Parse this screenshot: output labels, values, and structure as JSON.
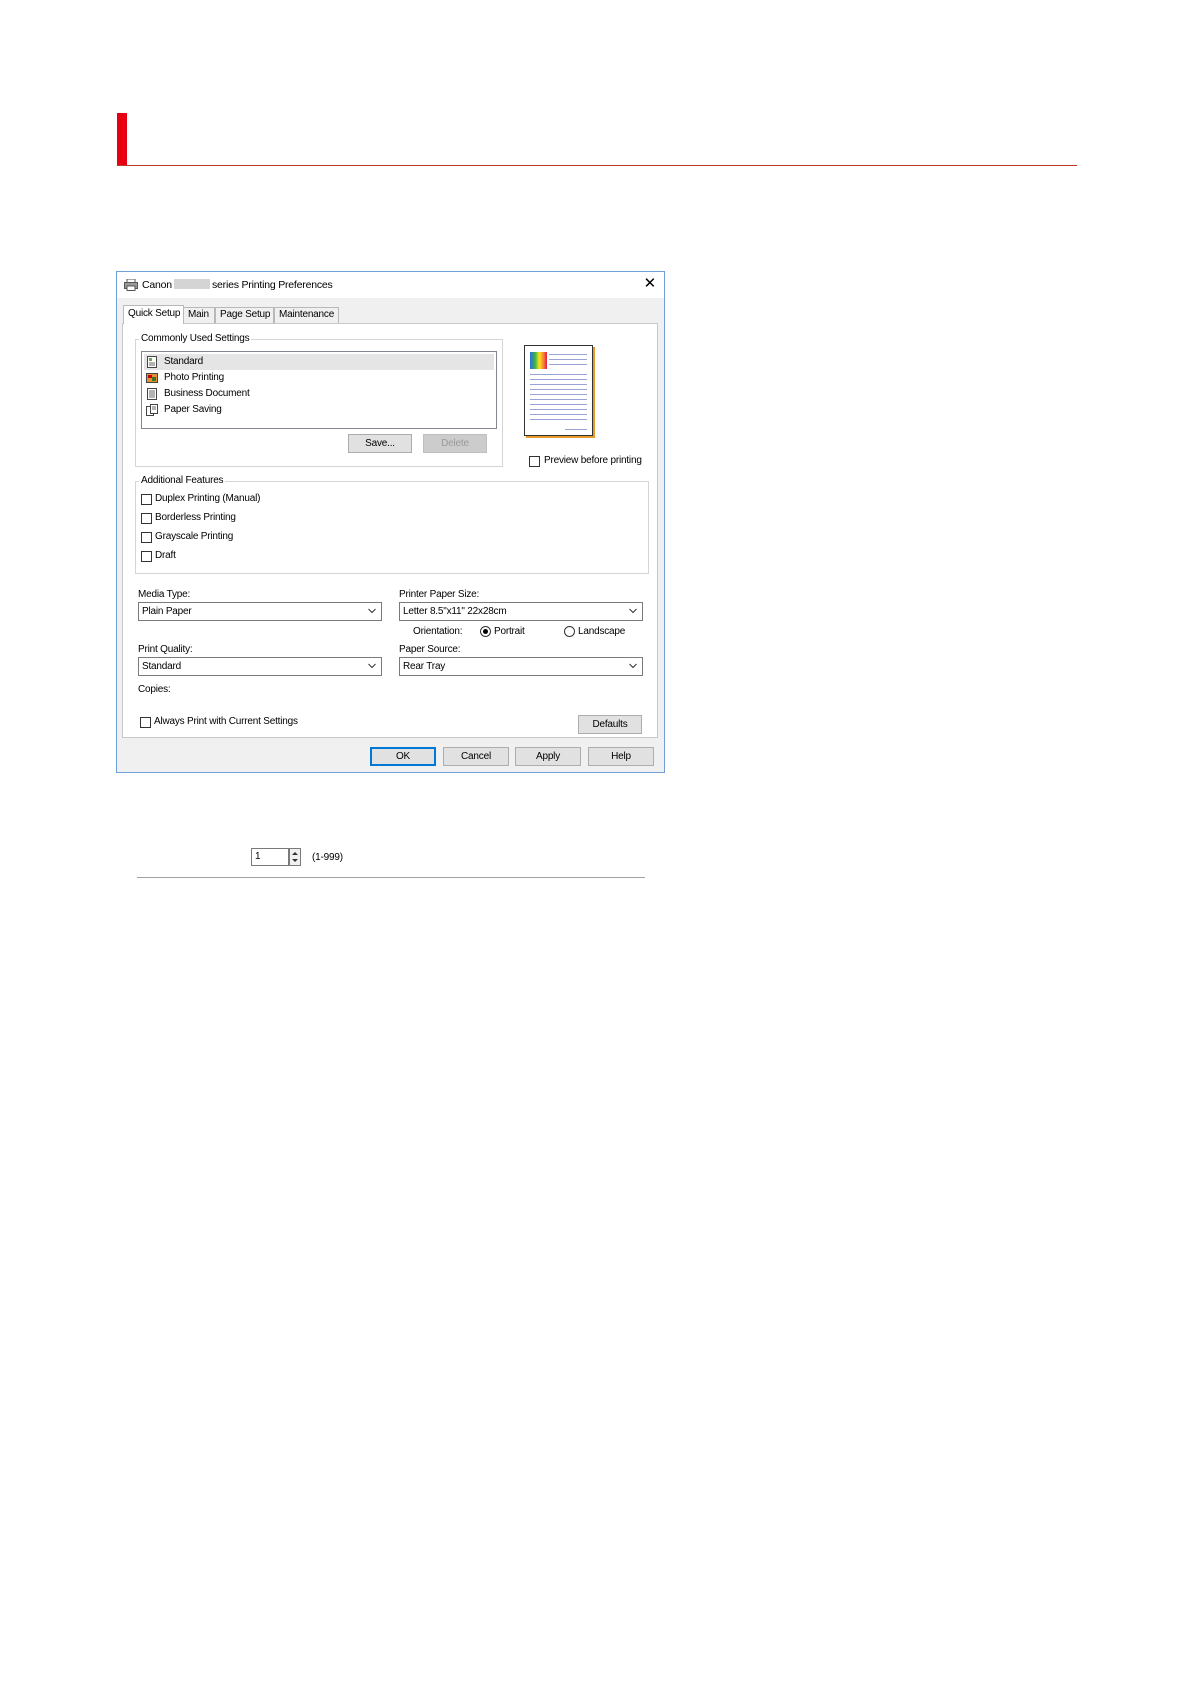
{
  "dialog": {
    "title_prefix": "Canon",
    "title_suffix": "series Printing Preferences",
    "close": "✕"
  },
  "tabs": [
    "Quick Setup",
    "Main",
    "Page Setup",
    "Maintenance"
  ],
  "commonly_used": {
    "label": "Commonly Used Settings",
    "items": [
      "Standard",
      "Photo Printing",
      "Business Document",
      "Paper Saving"
    ],
    "selected": "Standard",
    "save_button": "Save...",
    "delete_button": "Delete"
  },
  "preview": {
    "checkbox_label": "Preview before printing",
    "checked": false
  },
  "additional_features": {
    "label": "Additional Features",
    "items": [
      "Duplex Printing (Manual)",
      "Borderless Printing",
      "Grayscale Printing",
      "Draft"
    ]
  },
  "media_type": {
    "label": "Media Type:",
    "value": "Plain Paper"
  },
  "paper_size": {
    "label": "Printer Paper Size:",
    "value": "Letter 8.5\"x11\" 22x28cm"
  },
  "orientation": {
    "label": "Orientation:",
    "portrait": "Portrait",
    "landscape": "Landscape",
    "selected": "Portrait"
  },
  "print_quality": {
    "label": "Print Quality:",
    "value": "Standard"
  },
  "paper_source": {
    "label": "Paper Source:",
    "value": "Rear Tray"
  },
  "copies": {
    "label": "Copies:",
    "value": "1",
    "range": "(1-999)"
  },
  "always_print": {
    "label": "Always Print with Current Settings",
    "checked": false
  },
  "buttons": {
    "defaults": "Defaults",
    "ok": "OK",
    "cancel": "Cancel",
    "apply": "Apply",
    "help": "Help"
  },
  "colors": {
    "heading_accent": "#e60012",
    "window_border": "#6fa0d8",
    "default_button_border": "#0078d7"
  }
}
